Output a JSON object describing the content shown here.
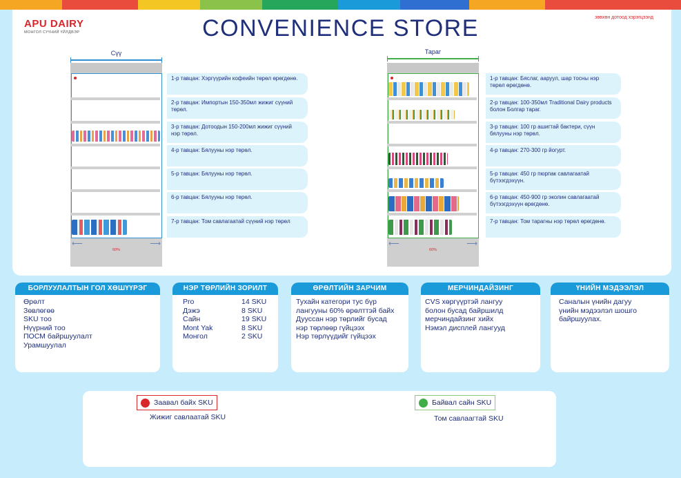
{
  "header": {
    "brand": "APU DAIRY",
    "brand_sub": "МОНГОЛ СҮҮНИЙ ҮЙЛДВЭР",
    "title": "CONVENIENCE STORE",
    "note": "зөвхөн дотоод хэрэгцээнд"
  },
  "colors": {
    "accent": "#1a9ad8",
    "title": "#1f2f7a",
    "brand_red": "#d8262b",
    "page_bg": "#c7ecfb",
    "must_have": "#d8262b",
    "recommended": "#3fae49"
  },
  "fridges": [
    {
      "label": "Сүү",
      "percent": "60%",
      "shelves": [
        "1-р тавцан: Хэргүүрийн кофеийн төрөл өрөгдөнө.",
        "2-р тавцан: Импортын 150-350мл жижиг сүүний төрөл.",
        "3-р тавцан: Дотоодын 150-200мл жижиг сүүний нэр төрөл.",
        "4-р тавцан: Бялууны нэр төрөл.",
        "5-р тавцан: Бялууны нэр төрөл.",
        "6-р тавцан: Бялууны нэр төрөл.",
        "7-р тавцан: Том савлагаатай сүүний нэр төрөл"
      ]
    },
    {
      "label": "Тараг",
      "percent": "60%",
      "shelves": [
        "1-р тавцан: Бяслаг, ааруул, шар тосны нэр төрөл өрөгдөнө.",
        "2-р тавцан: 100-350мл Traditional Dairy products болон Болгар тараг.",
        "3-р тавцан: 100 гр ашигтай бактери, сүүн бялууны нэр төрөл.",
        "4-р тавцан: 270-300 гр йогурт.",
        "5-р тавцан: 450 гр пюрпак савлагаатай бүтээгдэхүүн.",
        "6-р тавцан: 450-900 гр эколин савлагаатай бүтээгдэхүүн өрөгдөнө.",
        "7-р тавцан: Том тарагны нэр төрөл өрөгдөнө."
      ]
    }
  ],
  "cards": {
    "sales": {
      "title": "БОРЛУУЛАЛТЫН ГОЛ ХӨШҮҮРЭГ",
      "items": [
        "Өрөлт",
        "Зөвлөгөө",
        "SKU тоо",
        "Нүүрний тоо",
        "ПОСМ байршуулалт",
        "Урамшуулал"
      ]
    },
    "sku_goal": {
      "title": "НЭР ТӨРЛИЙН ЗОРИЛТ",
      "rows": [
        {
          "name": "Pro",
          "count": "14 SKU"
        },
        {
          "name": "Дэжэ",
          "count": "8 SKU"
        },
        {
          "name": "Сайн",
          "count": "19 SKU"
        },
        {
          "name": "Mont Yak",
          "count": "8 SKU"
        },
        {
          "name": "Монгол",
          "count": "2 SKU"
        }
      ]
    },
    "placement": {
      "title": "ӨРӨЛТИЙН ЗАРЧИМ",
      "items": [
        "Тухайн категори тус бүр",
        "лангууны 60% өрөлттэй байх",
        "Дуусcан нэр төрлийг буcад",
        "нэр төрлөөр гүйцээх",
        "Нэр төрлүүдийг гүйцээх"
      ]
    },
    "merch": {
      "title": "МЕРЧИНДАЙЗИНГ",
      "items": [
        "CVS хөргүүртэй лангуу",
        "болон бусад байршилд",
        "мерчиндайзинг хийх",
        "Нэмэл дисплей лангууд"
      ]
    },
    "price": {
      "title": "ҮНИЙН МЭДЭЭЛЭЛ",
      "items": [
        "Саналын үнийн дагуу",
        "үнийн мэдээлэл шошго",
        "байршуулах."
      ]
    }
  },
  "legend": {
    "must": {
      "label": "Заавал байх SKU",
      "sub": "Жижиг савлаатай SKU"
    },
    "should": {
      "label": "Байвал сайн SKU",
      "sub": "Том савлаагтай SKU"
    }
  }
}
